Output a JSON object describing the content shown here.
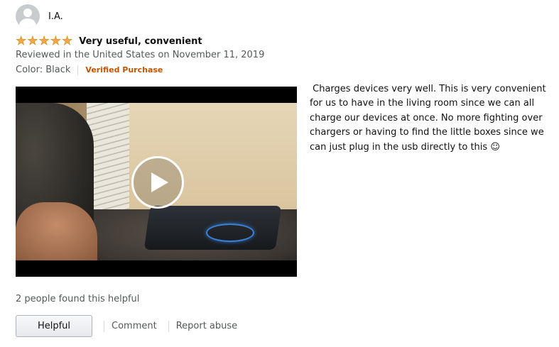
{
  "reviewer": {
    "name": "I.A."
  },
  "review": {
    "rating": 5,
    "rating_max": 5,
    "title": "Very useful, convenient",
    "reviewed_line": "Reviewed in the United States on November 11, 2019",
    "color_label": "Color: Black",
    "verified": "Verified Purchase",
    "body": " Charges devices very well. This is very convenient for us to have in the living room since we can all charge our devices at once. No more fighting over chargers or having to find the little boxes since we can just plug in the usb directly to this ☺"
  },
  "video": {
    "play_icon": "play-icon"
  },
  "footer": {
    "helpful_count": "2 people found this helpful",
    "helpful_button": "Helpful",
    "comment": "Comment",
    "report": "Report abuse"
  },
  "colors": {
    "star": "#f3a847",
    "verified": "#c45500",
    "meta": "#565959"
  }
}
